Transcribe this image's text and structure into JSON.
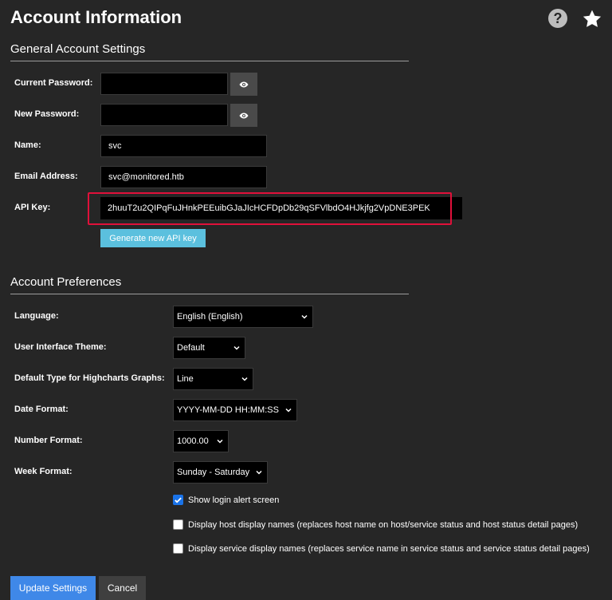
{
  "page": {
    "title": "Account Information"
  },
  "general": {
    "section_title": "General Account Settings",
    "current_password_label": "Current Password:",
    "current_password_value": "",
    "new_password_label": "New Password:",
    "new_password_value": "",
    "name_label": "Name:",
    "name_value": "svc",
    "email_label": "Email Address:",
    "email_value": "svc@monitored.htb",
    "api_key_label": "API Key:",
    "api_key_value": "2huuT2u2QIPqFuJHnkPEEuibGJaJIcHCFDpDb29qSFVlbdO4HJkjfg2VpDNE3PEK",
    "generate_button": "Generate new API key"
  },
  "preferences": {
    "section_title": "Account Preferences",
    "language_label": "Language:",
    "language_value": "English (English)",
    "theme_label": "User Interface Theme:",
    "theme_value": "Default",
    "highcharts_label": "Default Type for Highcharts Graphs:",
    "highcharts_value": "Line",
    "date_label": "Date Format:",
    "date_value": "YYYY-MM-DD HH:MM:SS",
    "number_label": "Number Format:",
    "number_value": "1000.00",
    "week_label": "Week Format:",
    "week_value": "Sunday - Saturday",
    "checkboxes": [
      {
        "label": "Show login alert screen",
        "checked": true
      },
      {
        "label": "Display host display names (replaces host name on host/service status and host status detail pages)",
        "checked": false
      },
      {
        "label": "Display service display names (replaces service name in service status and service status detail pages)",
        "checked": false
      }
    ]
  },
  "actions": {
    "update_button": "Update Settings",
    "cancel_button": "Cancel"
  },
  "colors": {
    "background": "#262626",
    "api_highlight": "#e0103a",
    "generate_button": "#5bc0de",
    "update_button": "#3f88e8",
    "checkbox_checked": "#1a73e8"
  },
  "icons": {
    "help": "help-icon",
    "favorite": "star-icon",
    "show_password": "eye-icon",
    "dropdown": "chevron-down-icon",
    "checkbox_checked": "checkmark-icon"
  }
}
